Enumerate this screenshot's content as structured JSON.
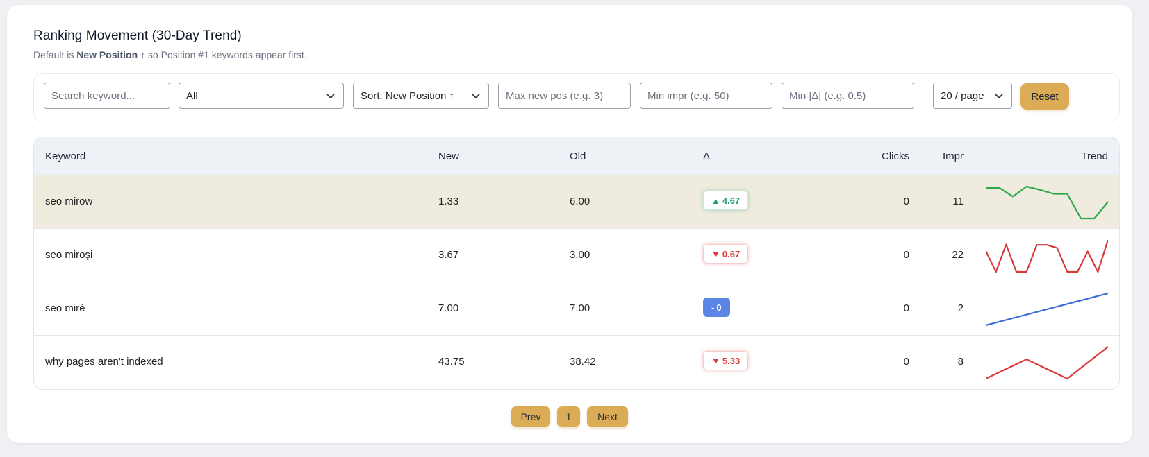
{
  "header": {
    "title": "Ranking Movement (30-Day Trend)",
    "subtitle_prefix": "Default is ",
    "subtitle_bold": "New Position ↑",
    "subtitle_suffix": " so Position #1 keywords appear first."
  },
  "filters": {
    "search_placeholder": "Search keyword...",
    "search_value": "",
    "category_value": "All",
    "sort_value": "Sort: New Position ↑",
    "max_new_pos_placeholder": "Max new pos (e.g. 3)",
    "min_impr_placeholder": "Min impr (e.g. 50)",
    "min_delta_placeholder": "Min |Δ| (e.g. 0.5)",
    "page_size_value": "20 / page",
    "reset_label": "Reset"
  },
  "table": {
    "columns": {
      "keyword": "Keyword",
      "new": "New",
      "old": "Old",
      "delta": "Δ",
      "clicks": "Clicks",
      "impr": "Impr",
      "trend": "Trend"
    },
    "rows": [
      {
        "keyword": "seo mirow",
        "new": "1.33",
        "old": "6.00",
        "delta_dir": "up",
        "delta_label": "4.67",
        "delta_icon": "▲",
        "clicks": "0",
        "impr": "11",
        "trend": [
          1.3,
          1.3,
          2.6,
          1.1,
          1.6,
          2.2,
          2.2,
          5.9,
          5.9,
          3.4
        ],
        "trend_color": "#2ea84f"
      },
      {
        "keyword": "seo miroşi",
        "new": "3.67",
        "old": "3.00",
        "delta_dir": "down",
        "delta_label": "0.67",
        "delta_icon": "▼",
        "clicks": "0",
        "impr": "22",
        "trend": [
          2.2,
          6.4,
          0.9,
          6.4,
          6.4,
          1.0,
          1.0,
          1.6,
          6.4,
          6.4,
          2.3,
          6.4,
          0.0
        ],
        "trend_color": "#d83a3a"
      },
      {
        "keyword": "seo miré",
        "new": "7.00",
        "old": "7.00",
        "delta_dir": "flat",
        "delta_label": "0",
        "delta_icon": "-",
        "clicks": "0",
        "impr": "2",
        "trend": [
          7.0,
          0.0
        ],
        "trend_color": "#3d6fd6"
      },
      {
        "keyword": "why pages aren't indexed",
        "new": "43.75",
        "old": "38.42",
        "delta_dir": "down",
        "delta_label": "5.33",
        "delta_icon": "▼",
        "clicks": "0",
        "impr": "8",
        "trend": [
          43.75,
          40.5,
          43.75,
          38.4
        ],
        "trend_color": "#d83a3a"
      }
    ]
  },
  "pagination": {
    "prev_label": "Prev",
    "current_page": "1",
    "next_label": "Next"
  }
}
